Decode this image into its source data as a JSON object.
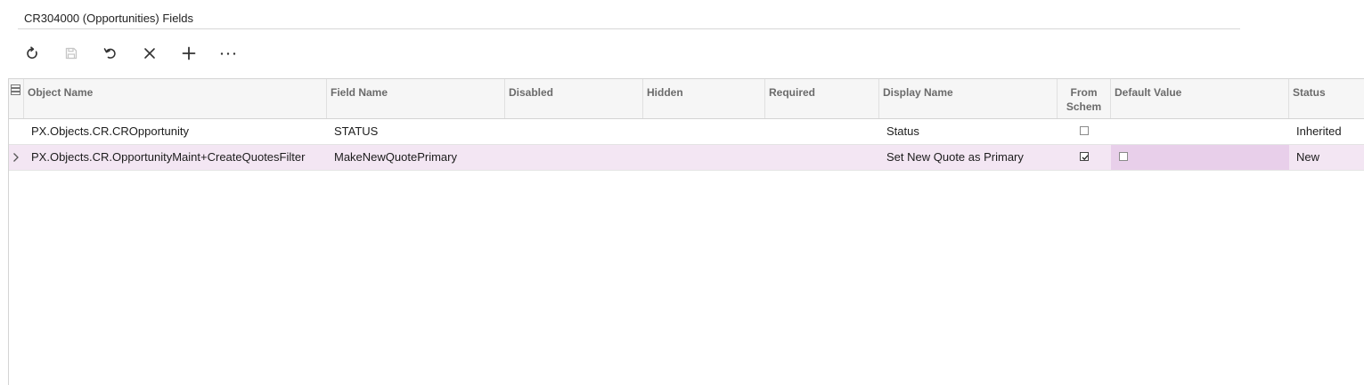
{
  "page": {
    "title": "CR304000 (Opportunities) Fields"
  },
  "toolbar": {
    "buttons": [
      {
        "name": "refresh",
        "icon": "refresh-icon"
      },
      {
        "name": "save",
        "icon": "save-icon"
      },
      {
        "name": "undo",
        "icon": "undo-icon"
      },
      {
        "name": "delete",
        "icon": "close-icon"
      },
      {
        "name": "add",
        "icon": "plus-icon"
      },
      {
        "name": "more",
        "icon": "more-icon"
      }
    ]
  },
  "grid": {
    "settings_icon": "grid-settings-icon",
    "columns": {
      "object_name": "Object Name",
      "field_name": "Field Name",
      "disabled": "Disabled",
      "hidden": "Hidden",
      "required": "Required",
      "display_name": "Display Name",
      "from_schema": "From Schem",
      "default_value": "Default Value",
      "status": "Status"
    },
    "rows": [
      {
        "object_name": "PX.Objects.CR.CROpportunity",
        "field_name": "STATUS",
        "disabled": "",
        "hidden": "",
        "required": "",
        "display_name": "Status",
        "from_schema": false,
        "default_value": "",
        "status": "Inherited"
      },
      {
        "object_name": "PX.Objects.CR.OpportunityMaint+CreateQuotesFilter",
        "field_name": "MakeNewQuotePrimary",
        "disabled": "",
        "hidden": "",
        "required": "",
        "display_name": "Set New Quote as Primary",
        "from_schema": true,
        "default_value": false,
        "status": "New"
      }
    ]
  },
  "colors": {
    "selected_row": "#f3e6f3",
    "editable_cell": "#e8cfea",
    "header_bg": "#f6f6f6",
    "header_text": "#6b6b6b"
  }
}
